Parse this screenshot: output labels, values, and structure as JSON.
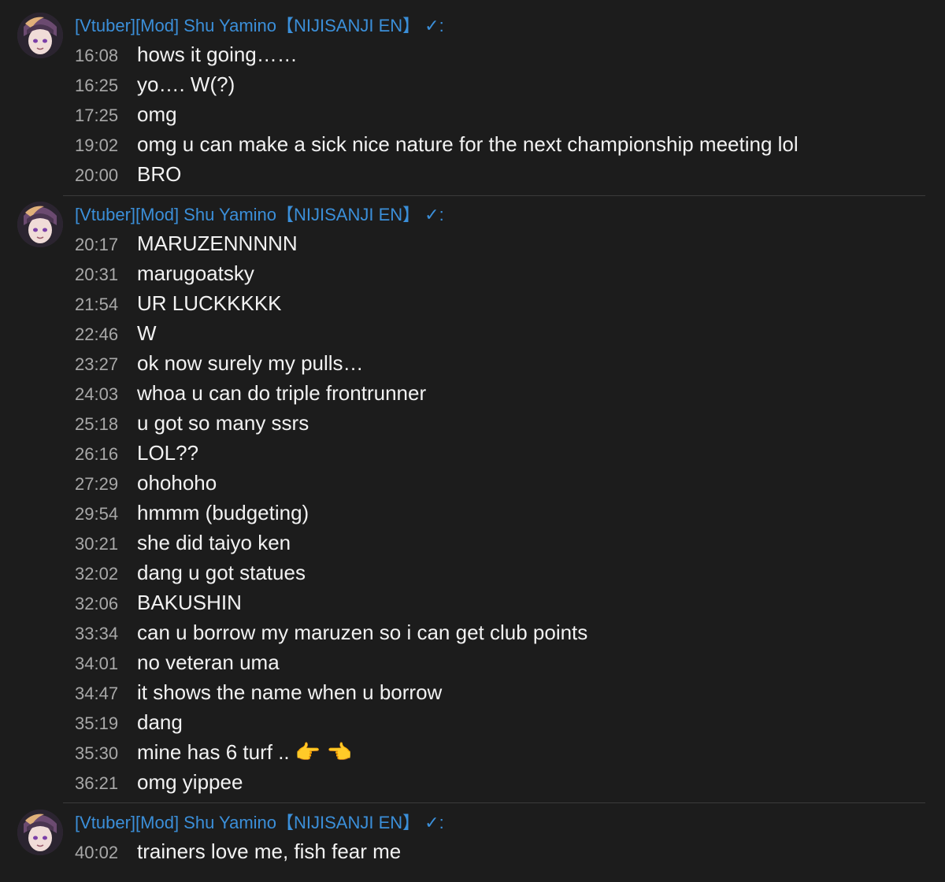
{
  "author_name": "[Vtuber][Mod] Shu Yamino【NIJISANJI EN】",
  "author_badge": "✓:",
  "groups": [
    {
      "messages": [
        {
          "time": "16:08",
          "text": "hows it going……"
        },
        {
          "time": "16:25",
          "text": "yo…. W(?)"
        },
        {
          "time": "17:25",
          "text": "omg"
        },
        {
          "time": "19:02",
          "text": "omg u can make a sick nice nature for the next championship meeting lol"
        },
        {
          "time": "20:00",
          "text": "BRO"
        }
      ]
    },
    {
      "messages": [
        {
          "time": "20:17",
          "text": "MARUZENNNNN"
        },
        {
          "time": "20:31",
          "text": "marugoatsky"
        },
        {
          "time": "21:54",
          "text": "UR LUCKKKKK"
        },
        {
          "time": "22:46",
          "text": "W"
        },
        {
          "time": "23:27",
          "text": "ok now surely my pulls…"
        },
        {
          "time": "24:03",
          "text": "whoa u can do triple frontrunner"
        },
        {
          "time": "25:18",
          "text": "u got so many ssrs"
        },
        {
          "time": "26:16",
          "text": "LOL??"
        },
        {
          "time": "27:29",
          "text": "ohohoho"
        },
        {
          "time": "29:54",
          "text": "hmmm (budgeting)"
        },
        {
          "time": "30:21",
          "text": "she did taiyo ken"
        },
        {
          "time": "32:02",
          "text": "dang u got statues"
        },
        {
          "time": "32:06",
          "text": "BAKUSHIN"
        },
        {
          "time": "33:34",
          "text": "can u borrow my maruzen so i can get club points"
        },
        {
          "time": "34:01",
          "text": "no veteran uma"
        },
        {
          "time": "34:47",
          "text": "it shows the name when u borrow"
        },
        {
          "time": "35:19",
          "text": "dang"
        },
        {
          "time": "35:30",
          "text": "mine has 6 turf .. 👉 👈"
        },
        {
          "time": "36:21",
          "text": "omg yippee"
        }
      ]
    },
    {
      "messages": [
        {
          "time": "40:02",
          "text": "trainers love me, fish fear me"
        }
      ]
    }
  ]
}
